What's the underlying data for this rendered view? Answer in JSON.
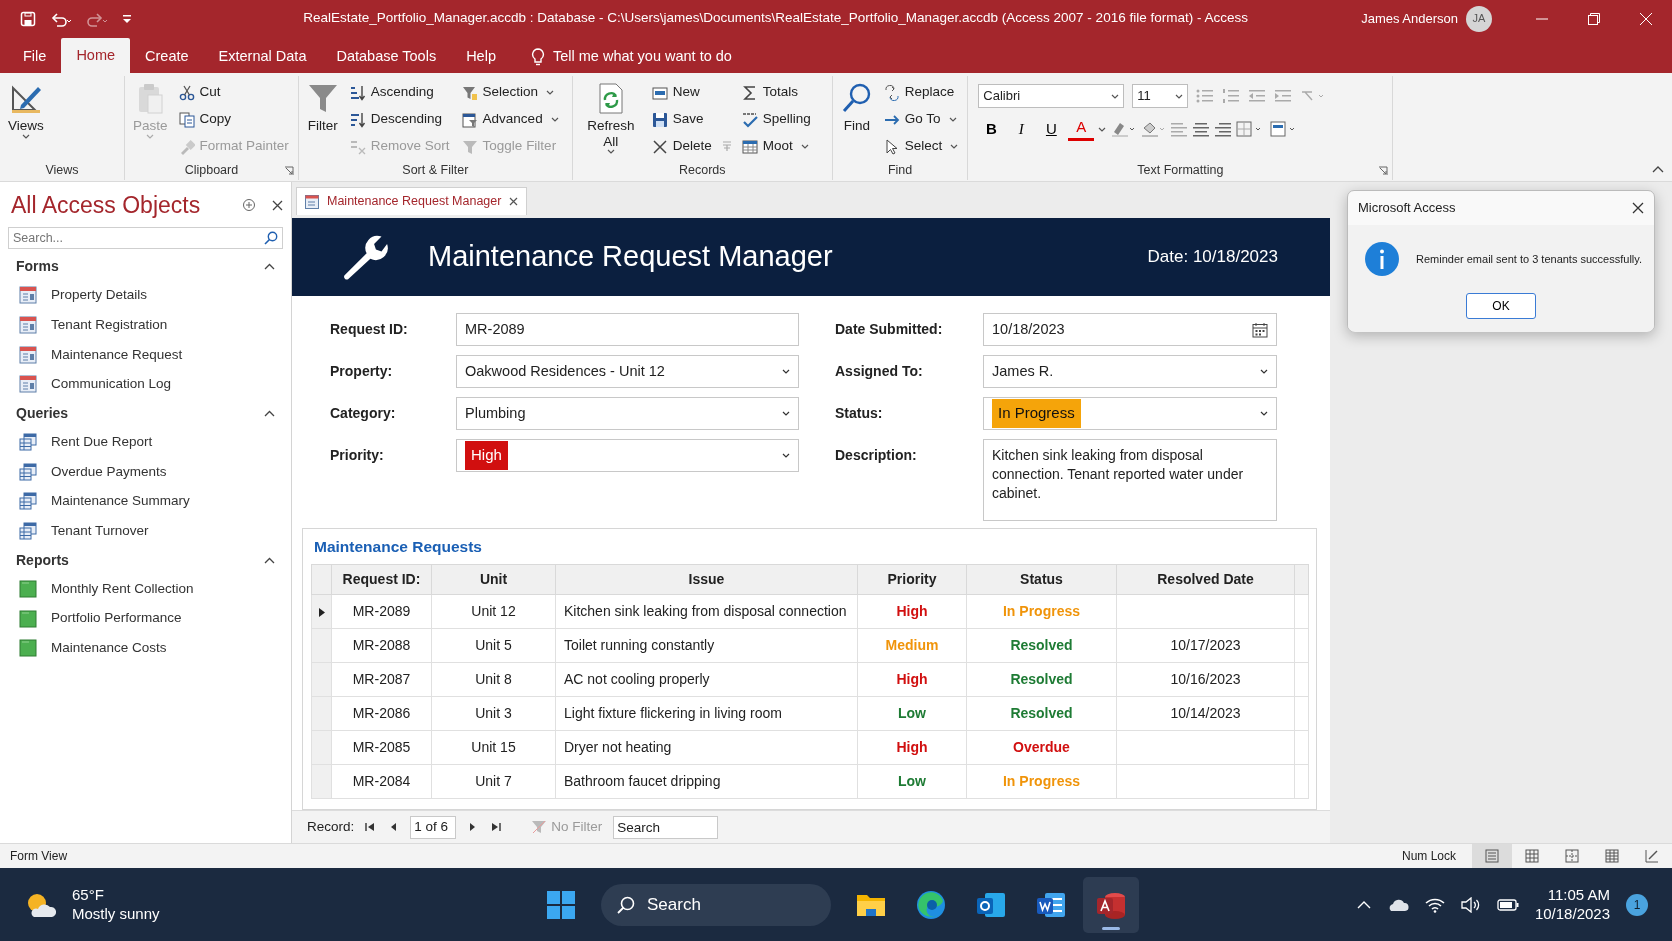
{
  "window": {
    "title": "RealEstate_Portfolio_Manager.accdb : Database - C:\\Users\\james\\Documents\\RealEstate_Portfolio_Manager.accdb (Access 2007 - 2016 file format)  -  Access",
    "user": "James Anderson",
    "initials": "JA"
  },
  "ribbon_tabs": [
    {
      "label": "File",
      "selected": false
    },
    {
      "label": "Home",
      "selected": true
    },
    {
      "label": "Create",
      "selected": false
    },
    {
      "label": "External Data",
      "selected": false
    },
    {
      "label": "Database Tools",
      "selected": false
    },
    {
      "label": "Help",
      "selected": false
    }
  ],
  "tell_me": "Tell me what you want to do",
  "ribbon": {
    "groups": [
      {
        "name": "Views",
        "kind": "commands",
        "launcher": false,
        "large": {
          "label": "Views",
          "dropdown": true,
          "disabled": false
        }
      },
      {
        "name": "Clipboard",
        "kind": "commands",
        "launcher": true,
        "large": {
          "label": "Paste",
          "dropdown": true,
          "disabled": true
        },
        "columns": [
          [
            {
              "label": "Cut",
              "dropdown": false,
              "disabled": false
            },
            {
              "label": "Copy",
              "dropdown": false,
              "disabled": false
            },
            {
              "label": "Format Painter",
              "dropdown": false,
              "disabled": true
            }
          ]
        ]
      },
      {
        "name": "Sort & Filter",
        "kind": "commands",
        "launcher": false,
        "large": {
          "label": "Filter",
          "dropdown": false,
          "disabled": false
        },
        "columns": [
          [
            {
              "label": "Ascending",
              "dropdown": false,
              "disabled": false
            },
            {
              "label": "Descending",
              "dropdown": false,
              "disabled": false
            },
            {
              "label": "Remove Sort",
              "dropdown": false,
              "disabled": true
            }
          ],
          [
            {
              "label": "Selection",
              "dropdown": true,
              "disabled": false
            },
            {
              "label": "Advanced",
              "dropdown": true,
              "disabled": false
            },
            {
              "label": "Toggle Filter",
              "dropdown": false,
              "disabled": true
            }
          ]
        ]
      },
      {
        "name": "Records",
        "kind": "commands",
        "launcher": false,
        "large": {
          "label": "Refresh All",
          "dropdown": true,
          "disabled": false
        },
        "columns": [
          [
            {
              "label": "New",
              "dropdown": false,
              "disabled": false
            },
            {
              "label": "Save",
              "dropdown": false,
              "disabled": false
            },
            {
              "label": "Delete",
              "dropdown": false,
              "disabled": false
            }
          ],
          [
            {
              "label": "Totals",
              "dropdown": false,
              "disabled": false
            },
            {
              "label": "Spelling",
              "dropdown": false,
              "disabled": false
            },
            {
              "label": "Moot",
              "dropdown": true,
              "disabled": false
            }
          ]
        ]
      },
      {
        "name": "Find",
        "kind": "commands",
        "launcher": false,
        "large": {
          "label": "Find",
          "dropdown": false,
          "disabled": false
        },
        "columns": [
          [
            {
              "label": "Replace",
              "dropdown": false,
              "disabled": false
            },
            {
              "label": "Go To",
              "dropdown": true,
              "disabled": false
            },
            {
              "label": "Select",
              "dropdown": true,
              "disabled": false
            }
          ]
        ]
      },
      {
        "name": "Text Formatting",
        "kind": "formatting",
        "launcher": true,
        "font": "Calibri",
        "size": "11",
        "buttons": [
          {
            "label": "B",
            "kind": "bold"
          },
          {
            "label": "I",
            "kind": "italic"
          },
          {
            "label": "U",
            "kind": "underline"
          },
          {
            "label": "A",
            "kind": "font-color"
          }
        ]
      }
    ]
  },
  "nav": {
    "title": "All Access Objects",
    "placeholder": "Search...",
    "sections": [
      {
        "name": "Forms",
        "kind": "form",
        "expanded": true,
        "items": [
          {
            "label": "Property Details"
          },
          {
            "label": "Tenant Registration"
          },
          {
            "label": "Maintenance Request"
          },
          {
            "label": "Communication Log"
          }
        ]
      },
      {
        "name": "Queries",
        "kind": "query",
        "expanded": true,
        "items": [
          {
            "label": "Rent Due Report"
          },
          {
            "label": "Overdue Payments"
          },
          {
            "label": "Maintenance Summary"
          },
          {
            "label": "Tenant Turnover"
          }
        ]
      },
      {
        "name": "Reports",
        "kind": "report",
        "expanded": true,
        "items": [
          {
            "label": "Monthly Rent Collection"
          },
          {
            "label": "Portfolio Performance"
          },
          {
            "label": "Maintenance Costs"
          }
        ]
      }
    ]
  },
  "document_tab": {
    "label": "Maintenance Request Manager",
    "selected": true
  },
  "form": {
    "title": "Maintenance Request Manager",
    "date": "Date: 10/18/2023",
    "columns": [
      [
        {
          "label": "Request ID:",
          "value": "MR-2089",
          "kind": "text"
        },
        {
          "label": "Property:",
          "value": "Oakwood Residences - Unit 12",
          "kind": "combo"
        },
        {
          "label": "Category:",
          "value": "Plumbing",
          "kind": "combo"
        },
        {
          "label": "Priority:",
          "value": "High",
          "kind": "combo",
          "color": "#d10f0f"
        }
      ],
      [
        {
          "label": "Date Submitted:",
          "value": "10/18/2023",
          "kind": "date"
        },
        {
          "label": "Assigned To:",
          "value": "James R.",
          "kind": "combo"
        },
        {
          "label": "Status:",
          "value": "In Progress",
          "kind": "combo",
          "color": "#f5a40a"
        },
        {
          "label": "Description:",
          "value": "Kitchen sink leaking from disposal connection. Tenant reported water under cabinet.",
          "kind": "memo"
        }
      ]
    ],
    "subform": {
      "title": "Maintenance Requests",
      "columns": [
        "Request ID:",
        "Unit",
        "Issue",
        "Priority",
        "Status",
        "Resolved Date"
      ],
      "rows": [
        {
          "selected": true,
          "request_id": "MR-2089",
          "unit": "Unit 12",
          "issue": "Kitchen sink leaking from disposal connection",
          "priority": {
            "label": "High",
            "color": "#d10f0f"
          },
          "status": {
            "label": "In Progress",
            "color": "#f0940a"
          }
        },
        {
          "selected": false,
          "request_id": "MR-2088",
          "unit": "Unit 5",
          "issue": "Toilet running constantly",
          "priority": {
            "label": "Medium",
            "color": "#f0940a"
          },
          "status": {
            "label": "Resolved",
            "color": "#1e7b34"
          },
          "resolved_date": "10/17/2023"
        },
        {
          "selected": false,
          "request_id": "MR-2087",
          "unit": "Unit 8",
          "issue": "AC not cooling properly",
          "priority": {
            "label": "High",
            "color": "#d10f0f"
          },
          "status": {
            "label": "Resolved",
            "color": "#1e7b34"
          },
          "resolved_date": "10/16/2023"
        },
        {
          "selected": false,
          "request_id": "MR-2086",
          "unit": "Unit 3",
          "issue": "Light fixture flickering in living room",
          "priority": {
            "label": "Low",
            "color": "#1e7b34"
          },
          "status": {
            "label": "Resolved",
            "color": "#1e7b34"
          },
          "resolved_date": "10/14/2023"
        },
        {
          "selected": false,
          "request_id": "MR-2085",
          "unit": "Unit 15",
          "issue": "Dryer not heating",
          "priority": {
            "label": "High",
            "color": "#d10f0f"
          },
          "status": {
            "label": "Overdue",
            "color": "#d10f0f"
          }
        },
        {
          "selected": false,
          "request_id": "MR-2084",
          "unit": "Unit 7",
          "issue": "Bathroom faucet dripping",
          "priority": {
            "label": "Low",
            "color": "#1e7b34"
          },
          "status": {
            "label": "In Progress",
            "color": "#f0940a"
          }
        }
      ]
    },
    "record_nav": {
      "label": "Record:",
      "position": "1 of 6",
      "filter": "No Filter",
      "filter_disabled": true,
      "placeholder": "Search"
    }
  },
  "dialog": {
    "title": "Microsoft Access",
    "message": "Reminder email sent to 3 tenants successfully.",
    "button": "OK"
  },
  "status_bar": {
    "mode": "Form View",
    "indicator": "Num Lock",
    "views": [
      {
        "selected": true
      },
      {
        "selected": false
      },
      {
        "selected": false
      },
      {
        "selected": false
      },
      {
        "selected": false
      }
    ]
  },
  "taskbar": {
    "temperature": "65°F",
    "weather": "Mostly sunny",
    "search": "Search",
    "apps": [
      {
        "selected": false
      },
      {
        "selected": false
      },
      {
        "selected": false
      },
      {
        "selected": false
      },
      {
        "selected": true
      }
    ],
    "time": "11:05 AM",
    "date": "10/18/2023",
    "notifications": "1"
  }
}
